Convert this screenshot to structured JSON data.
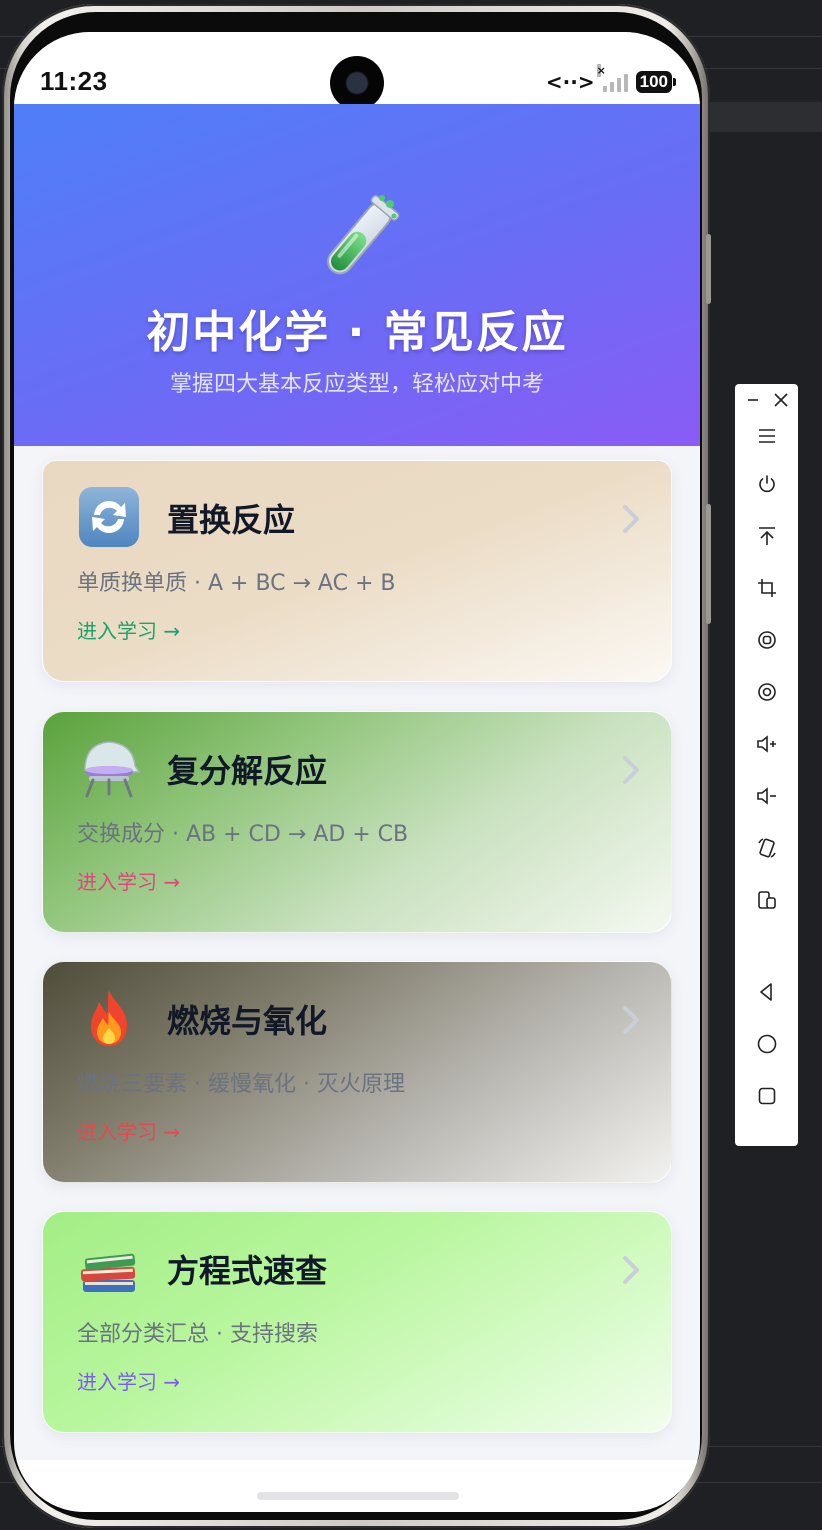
{
  "status_bar": {
    "time": "11:23",
    "battery": "100"
  },
  "header": {
    "title": "初中化学 · 常见反应",
    "subtitle": "掌握四大基本反应类型，轻松应对中考",
    "icon": "test-tube-icon"
  },
  "cards": [
    {
      "title": "置换反应",
      "desc": "单质换单质 · A + BC → AC + B",
      "link": "进入学习 →",
      "icon": "swap-arrows-icon",
      "link_color": "#1aa36b"
    },
    {
      "title": "复分解反应",
      "desc": "交换成分 · AB + CD → AD + CB",
      "link": "进入学习 →",
      "icon": "flask-icon",
      "link_color": "#e0457b"
    },
    {
      "title": "燃烧与氧化",
      "desc": "燃烧三要素 · 缓慢氧化 · 灭火原理",
      "link": "进入学习 →",
      "icon": "fire-icon",
      "link_color": "#e5484d"
    },
    {
      "title": "方程式速查",
      "desc": "全部分类汇总 · 支持搜索",
      "link": "进入学习 →",
      "icon": "books-icon",
      "link_color": "#7c5cf0"
    }
  ],
  "toolbar": {
    "items": [
      "menu-icon",
      "power-icon",
      "upload-icon",
      "crop-icon",
      "rotate-icon",
      "screenshot-icon",
      "volume-up-icon",
      "volume-down-icon",
      "rotate-device-icon",
      "multi-device-icon",
      "back-icon",
      "home-icon",
      "recents-icon"
    ]
  }
}
